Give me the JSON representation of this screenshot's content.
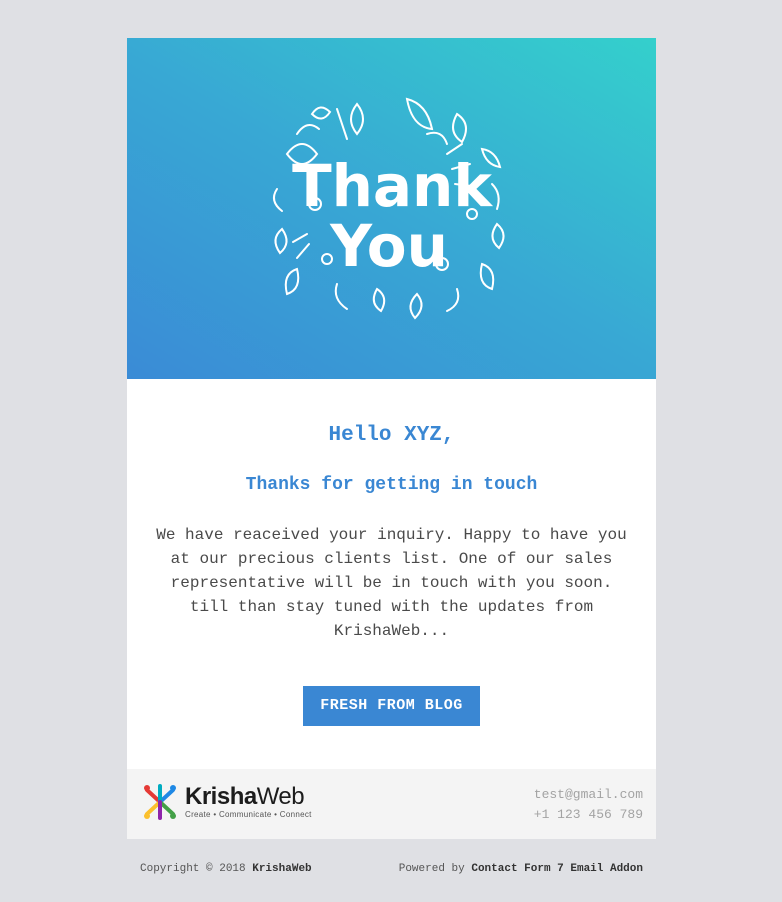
{
  "hero": {
    "image_alt": "Thank You",
    "line1": "Thank",
    "line2": "You"
  },
  "main": {
    "greeting": "Hello XYZ,",
    "subtitle": "Thanks for getting in touch",
    "message": "We have reaceived your inquiry. Happy to have you at our precious clients list. One of our sales representative will be in touch with you soon. till than stay tuned with the updates from KrishaWeb...",
    "button_label": "FRESH FROM BLOG"
  },
  "brand": {
    "name_bold": "Krisha",
    "name_regular": "Web",
    "tagline": "Create • Communicate • Connect"
  },
  "contact": {
    "email": "test@gmail.com",
    "phone": "+1 123 456 789"
  },
  "page_footer": {
    "copyright_prefix": "Copyright © 2018",
    "copyright_brand": "KrishaWeb",
    "powered_prefix": "Powered by",
    "powered_link": "Contact Form 7 Email Addon"
  },
  "colors": {
    "accent": "#3a87d3",
    "page_bg": "#dfe0e4",
    "gradient_start": "#3a8bd6",
    "gradient_end": "#34d0cc"
  }
}
